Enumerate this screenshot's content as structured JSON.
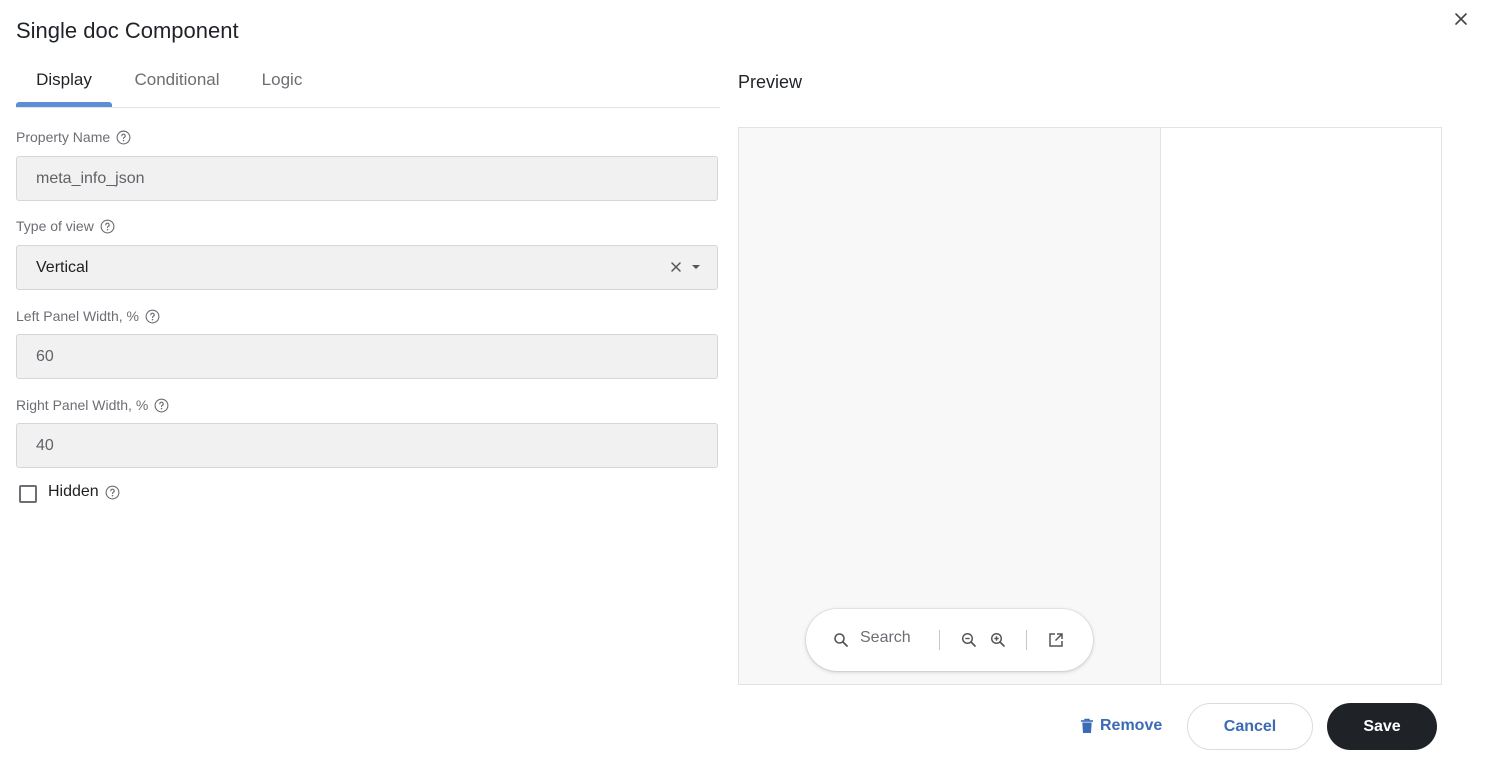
{
  "dialog": {
    "title": "Single doc Component"
  },
  "tabs": [
    {
      "label": "Display",
      "active": true
    },
    {
      "label": "Conditional",
      "active": false
    },
    {
      "label": "Logic",
      "active": false
    }
  ],
  "form": {
    "property_name": {
      "label": "Property Name",
      "value": "meta_info_json"
    },
    "type_of_view": {
      "label": "Type of view",
      "value": "Vertical"
    },
    "left_panel_width": {
      "label": "Left Panel Width, %",
      "value": "60"
    },
    "right_panel_width": {
      "label": "Right Panel Width, %",
      "value": "40"
    },
    "hidden": {
      "label": "Hidden",
      "checked": false
    }
  },
  "preview": {
    "title": "Preview",
    "toolbar": {
      "search_placeholder": "Search"
    }
  },
  "footer": {
    "remove_label": "Remove",
    "cancel_label": "Cancel",
    "save_label": "Save"
  },
  "colors": {
    "accent": "#5b8fd6",
    "link": "#3c6bb5",
    "primary_button": "#1f2328",
    "field_bg": "#f1f1f1"
  }
}
